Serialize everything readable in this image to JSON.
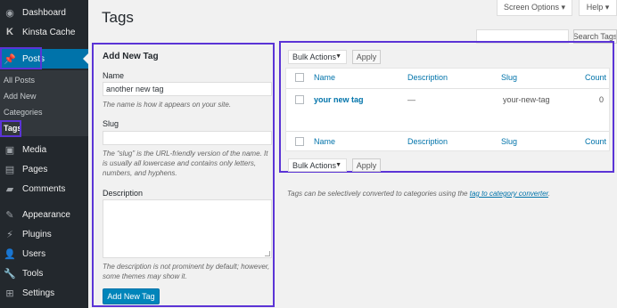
{
  "sidebar": {
    "dashboard": "Dashboard",
    "kinsta_cache": "Kinsta Cache",
    "posts": "Posts",
    "submenu": [
      "All Posts",
      "Add New",
      "Categories",
      "Tags"
    ],
    "media": "Media",
    "pages": "Pages",
    "comments": "Comments",
    "appearance": "Appearance",
    "plugins": "Plugins",
    "users": "Users",
    "tools": "Tools",
    "settings": "Settings",
    "highlight_color": "#5b34d6",
    "active_color": "#0073aa"
  },
  "header": {
    "title": "Tags",
    "screen_options": "Screen Options ▾",
    "help": "Help ▾",
    "search_button": "Search Tags"
  },
  "form": {
    "title": "Add New Tag",
    "name_label": "Name",
    "name_value": "another new tag",
    "name_hint": "The name is how it appears on your site.",
    "slug_label": "Slug",
    "slug_hint": "The “slug” is the URL-friendly version of the name. It is usually all lowercase and contains only letters, numbers, and hyphens.",
    "description_label": "Description",
    "description_hint": "The description is not prominent by default; however, some themes may show it.",
    "submit_label": "Add New Tag"
  },
  "table": {
    "bulk_actions": "Bulk Actions",
    "apply": "Apply",
    "columns": {
      "name": "Name",
      "description": "Description",
      "slug": "Slug",
      "count": "Count"
    },
    "rows": [
      {
        "name": "your new tag",
        "description": "—",
        "slug": "your-new-tag",
        "count": "0"
      }
    ]
  },
  "footer": {
    "note_prefix": "Tags can be selectively converted to categories using the ",
    "link_text": "tag to category converter",
    "note_suffix": "."
  }
}
